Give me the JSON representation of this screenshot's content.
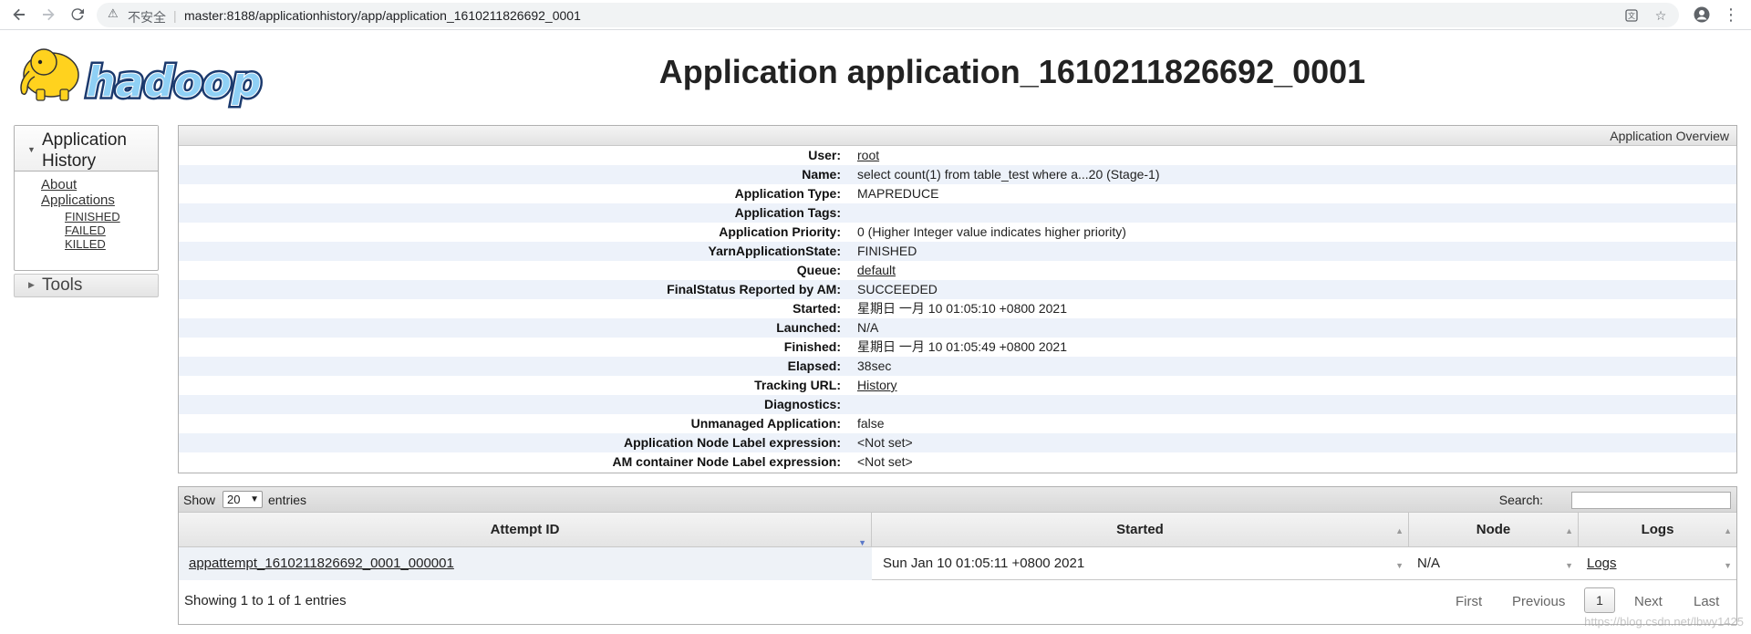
{
  "browser": {
    "security_label": "不安全",
    "url": "master:8188/applicationhistory/app/application_1610211826692_0001"
  },
  "page": {
    "title": "Application application_1610211826692_0001"
  },
  "nav": {
    "section_label": "Application History",
    "about": "About",
    "applications": "Applications",
    "sub_items": [
      "FINISHED",
      "FAILED",
      "KILLED"
    ],
    "tools_label": "Tools"
  },
  "overview": {
    "header": "Application Overview",
    "rows": [
      {
        "key": "User:",
        "value": "root",
        "link": true
      },
      {
        "key": "Name:",
        "value": "select count(1) from table_test where a...20 (Stage-1)",
        "link": false
      },
      {
        "key": "Application Type:",
        "value": "MAPREDUCE",
        "link": false
      },
      {
        "key": "Application Tags:",
        "value": "",
        "link": false
      },
      {
        "key": "Application Priority:",
        "value": "0 (Higher Integer value indicates higher priority)",
        "link": false
      },
      {
        "key": "YarnApplicationState:",
        "value": "FINISHED",
        "link": false
      },
      {
        "key": "Queue:",
        "value": "default",
        "link": true
      },
      {
        "key": "FinalStatus Reported by AM:",
        "value": "SUCCEEDED",
        "link": false
      },
      {
        "key": "Started:",
        "value": "星期日 一月 10 01:05:10 +0800 2021",
        "link": false
      },
      {
        "key": "Launched:",
        "value": "N/A",
        "link": false
      },
      {
        "key": "Finished:",
        "value": "星期日 一月 10 01:05:49 +0800 2021",
        "link": false
      },
      {
        "key": "Elapsed:",
        "value": "38sec",
        "link": false
      },
      {
        "key": "Tracking URL:",
        "value": "History",
        "link": true
      },
      {
        "key": "Diagnostics:",
        "value": "",
        "link": false
      },
      {
        "key": "Unmanaged Application:",
        "value": "false",
        "link": false
      },
      {
        "key": "Application Node Label expression:",
        "value": "<Not set>",
        "link": false
      },
      {
        "key": "AM container Node Label expression:",
        "value": "<Not set>",
        "link": false
      }
    ]
  },
  "attempts": {
    "show_label": "Show",
    "page_size": "20",
    "entries_label": "entries",
    "search_label": "Search:",
    "columns": [
      "Attempt ID",
      "Started",
      "Node",
      "Logs"
    ],
    "rows": [
      {
        "attempt_id": "appattempt_1610211826692_0001_000001",
        "started": "Sun Jan 10 01:05:11 +0800 2021",
        "node": "N/A",
        "logs": "Logs"
      }
    ],
    "info": "Showing 1 to 1 of 1 entries",
    "pagination": {
      "first": "First",
      "previous": "Previous",
      "current": "1",
      "next": "Next",
      "last": "Last"
    }
  },
  "watermark": "https://blog.csdn.net/lbwy1425"
}
